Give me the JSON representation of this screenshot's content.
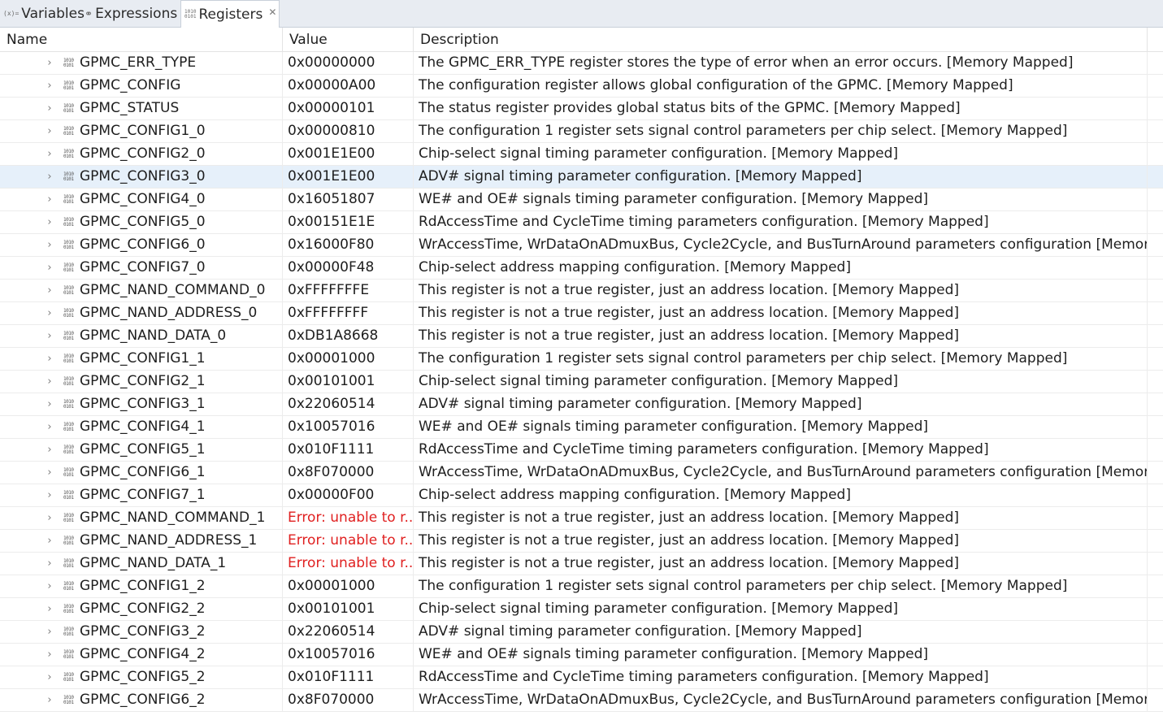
{
  "tabs": [
    {
      "label": "Variables",
      "icon": "(x)="
    },
    {
      "label": "Expressions",
      "icon": "⚭"
    },
    {
      "label": "Registers",
      "icon": "1010\n0101",
      "active": true
    }
  ],
  "columns": {
    "name": "Name",
    "value": "Value",
    "description": "Description"
  },
  "selected_row": 5,
  "rows": [
    {
      "name": "GPMC_ERR_TYPE",
      "value": "0x00000000",
      "description": "The GPMC_ERR_TYPE register stores the type of error when an error occurs. [Memory Mapped]"
    },
    {
      "name": "GPMC_CONFIG",
      "value": "0x00000A00",
      "description": "The configuration register allows global configuration of the GPMC. [Memory Mapped]"
    },
    {
      "name": "GPMC_STATUS",
      "value": "0x00000101",
      "description": "The status register provides global status bits of the GPMC. [Memory Mapped]"
    },
    {
      "name": "GPMC_CONFIG1_0",
      "value": "0x00000810",
      "description": "The configuration 1 register sets signal control parameters per chip select. [Memory Mapped]"
    },
    {
      "name": "GPMC_CONFIG2_0",
      "value": "0x001E1E00",
      "description": "Chip-select signal timing parameter configuration. [Memory Mapped]"
    },
    {
      "name": "GPMC_CONFIG3_0",
      "value": "0x001E1E00",
      "description": "ADV# signal timing parameter configuration. [Memory Mapped]"
    },
    {
      "name": "GPMC_CONFIG4_0",
      "value": "0x16051807",
      "description": "WE# and OE# signals timing parameter configuration. [Memory Mapped]"
    },
    {
      "name": "GPMC_CONFIG5_0",
      "value": "0x00151E1E",
      "description": "RdAccessTime and CycleTime timing parameters configuration. [Memory Mapped]"
    },
    {
      "name": "GPMC_CONFIG6_0",
      "value": "0x16000F80",
      "description": "WrAccessTime, WrDataOnADmuxBus, Cycle2Cycle, and BusTurnAround parameters configuration [Memory Ma..."
    },
    {
      "name": "GPMC_CONFIG7_0",
      "value": "0x00000F48",
      "description": "Chip-select address mapping configuration. [Memory Mapped]"
    },
    {
      "name": "GPMC_NAND_COMMAND_0",
      "value": "0xFFFFFFFE",
      "description": "This register is not a true register, just an address location. [Memory Mapped]"
    },
    {
      "name": "GPMC_NAND_ADDRESS_0",
      "value": "0xFFFFFFFF",
      "description": "This register is not a true register, just an address location. [Memory Mapped]"
    },
    {
      "name": "GPMC_NAND_DATA_0",
      "value": "0xDB1A8668",
      "description": "This register is not a true register, just an address location. [Memory Mapped]"
    },
    {
      "name": "GPMC_CONFIG1_1",
      "value": "0x00001000",
      "description": "The configuration 1 register sets signal control parameters per chip select. [Memory Mapped]"
    },
    {
      "name": "GPMC_CONFIG2_1",
      "value": "0x00101001",
      "description": "Chip-select signal timing parameter configuration. [Memory Mapped]"
    },
    {
      "name": "GPMC_CONFIG3_1",
      "value": "0x22060514",
      "description": "ADV# signal timing parameter configuration. [Memory Mapped]"
    },
    {
      "name": "GPMC_CONFIG4_1",
      "value": "0x10057016",
      "description": "WE# and OE# signals timing parameter configuration. [Memory Mapped]"
    },
    {
      "name": "GPMC_CONFIG5_1",
      "value": "0x010F1111",
      "description": "RdAccessTime and CycleTime timing parameters configuration. [Memory Mapped]"
    },
    {
      "name": "GPMC_CONFIG6_1",
      "value": "0x8F070000",
      "description": "WrAccessTime, WrDataOnADmuxBus, Cycle2Cycle, and BusTurnAround parameters configuration [Memory Ma..."
    },
    {
      "name": "GPMC_CONFIG7_1",
      "value": "0x00000F00",
      "description": "Chip-select address mapping configuration. [Memory Mapped]"
    },
    {
      "name": "GPMC_NAND_COMMAND_1",
      "value": "Error: unable to r...",
      "error": true,
      "description": "This register is not a true register, just an address location. [Memory Mapped]"
    },
    {
      "name": "GPMC_NAND_ADDRESS_1",
      "value": "Error: unable to r...",
      "error": true,
      "description": "This register is not a true register, just an address location. [Memory Mapped]"
    },
    {
      "name": "GPMC_NAND_DATA_1",
      "value": "Error: unable to r...",
      "error": true,
      "description": "This register is not a true register, just an address location. [Memory Mapped]"
    },
    {
      "name": "GPMC_CONFIG1_2",
      "value": "0x00001000",
      "description": "The configuration 1 register sets signal control parameters per chip select. [Memory Mapped]"
    },
    {
      "name": "GPMC_CONFIG2_2",
      "value": "0x00101001",
      "description": "Chip-select signal timing parameter configuration. [Memory Mapped]"
    },
    {
      "name": "GPMC_CONFIG3_2",
      "value": "0x22060514",
      "description": "ADV# signal timing parameter configuration. [Memory Mapped]"
    },
    {
      "name": "GPMC_CONFIG4_2",
      "value": "0x10057016",
      "description": "WE# and OE# signals timing parameter configuration. [Memory Mapped]"
    },
    {
      "name": "GPMC_CONFIG5_2",
      "value": "0x010F1111",
      "description": "RdAccessTime and CycleTime timing parameters configuration. [Memory Mapped]"
    },
    {
      "name": "GPMC_CONFIG6_2",
      "value": "0x8F070000",
      "description": "WrAccessTime, WrDataOnADmuxBus, Cycle2Cycle, and BusTurnAround parameters configuration [Memory Ma..."
    }
  ],
  "icons": {
    "expand": "chevron-right-icon",
    "register": "register-icon",
    "close": "close-icon"
  },
  "colors": {
    "selection": "#e6f0fa",
    "error": "#e02020",
    "tabbar": "#e8ecf2"
  }
}
